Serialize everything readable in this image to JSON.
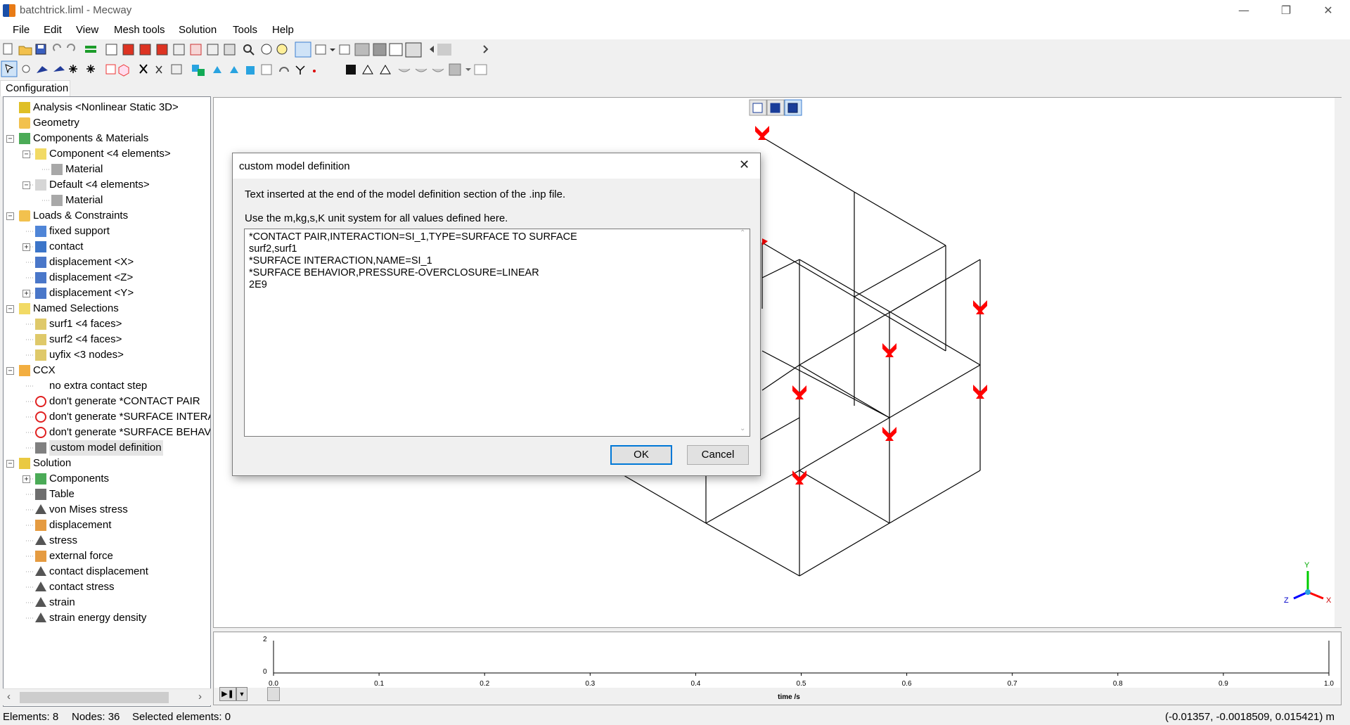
{
  "window": {
    "title": "batchtrick.liml - Mecway",
    "controls": [
      "minimize",
      "restore",
      "close"
    ]
  },
  "menu": [
    "File",
    "Edit",
    "View",
    "Mesh tools",
    "Solution",
    "Tools",
    "Help"
  ],
  "sidebar": {
    "tab": "Configuration",
    "tree": [
      {
        "label": "Analysis <Nonlinear Static 3D>",
        "icon": "analysis-icon",
        "level": 0,
        "expander": ""
      },
      {
        "label": "Geometry",
        "icon": "folder-icon",
        "level": 0,
        "expander": ""
      },
      {
        "label": "Components & Materials",
        "icon": "components-icon",
        "level": 0,
        "expander": "−"
      },
      {
        "label": "Component <4 elements>",
        "icon": "component-icon",
        "level": 1,
        "expander": "−"
      },
      {
        "label": "Material",
        "icon": "material-icon",
        "level": 2,
        "expander": ""
      },
      {
        "label": "Default <4 elements>",
        "icon": "component-default-icon",
        "level": 1,
        "expander": "−"
      },
      {
        "label": "Material",
        "icon": "material-icon",
        "level": 2,
        "expander": ""
      },
      {
        "label": "Loads & Constraints",
        "icon": "loads-folder-icon",
        "level": 0,
        "expander": "−"
      },
      {
        "label": "fixed support",
        "icon": "fixed-support-icon",
        "level": 1,
        "expander": ""
      },
      {
        "label": "contact",
        "icon": "contact-icon",
        "level": 1,
        "expander": "+"
      },
      {
        "label": "displacement <X>",
        "icon": "displacement-constraint-icon",
        "level": 1,
        "expander": ""
      },
      {
        "label": "displacement <Z>",
        "icon": "displacement-constraint-icon",
        "level": 1,
        "expander": ""
      },
      {
        "label": "displacement <Y>",
        "icon": "displacement-constraint-icon",
        "level": 1,
        "expander": "+"
      },
      {
        "label": "Named Selections",
        "icon": "named-selections-icon",
        "level": 0,
        "expander": "−"
      },
      {
        "label": "surf1 <4 faces>",
        "icon": "face-selection-icon",
        "level": 1,
        "expander": ""
      },
      {
        "label": "surf2 <4 faces>",
        "icon": "face-selection-icon",
        "level": 1,
        "expander": ""
      },
      {
        "label": "uyfix <3 nodes>",
        "icon": "node-selection-icon",
        "level": 1,
        "expander": ""
      },
      {
        "label": "CCX",
        "icon": "ccx-icon",
        "level": 0,
        "expander": "−"
      },
      {
        "label": "no extra contact step",
        "icon": "",
        "level": 1,
        "expander": ""
      },
      {
        "label": "don't generate *CONTACT PAIR",
        "icon": "no-generate-icon",
        "level": 1,
        "expander": ""
      },
      {
        "label": "don't generate *SURFACE INTERA",
        "icon": "no-generate-icon",
        "level": 1,
        "expander": ""
      },
      {
        "label": "don't generate *SURFACE BEHAV",
        "icon": "no-generate-icon",
        "level": 1,
        "expander": ""
      },
      {
        "label": "custom model definition",
        "icon": "custom-definition-icon",
        "level": 1,
        "expander": "",
        "selected": true
      },
      {
        "label": "Solution",
        "icon": "solution-icon",
        "level": 0,
        "expander": "−"
      },
      {
        "label": "Components",
        "icon": "components-icon",
        "level": 1,
        "expander": "+"
      },
      {
        "label": "Table",
        "icon": "table-icon",
        "level": 1,
        "expander": ""
      },
      {
        "label": "von Mises stress",
        "icon": "triangle-icon",
        "level": 1,
        "expander": ""
      },
      {
        "label": "displacement",
        "icon": "displacement-arrow-icon",
        "level": 1,
        "expander": ""
      },
      {
        "label": "stress",
        "icon": "triangle-icon",
        "level": 1,
        "expander": ""
      },
      {
        "label": "external force",
        "icon": "displacement-arrow-icon",
        "level": 1,
        "expander": ""
      },
      {
        "label": "contact displacement",
        "icon": "triangle-icon",
        "level": 1,
        "expander": ""
      },
      {
        "label": "contact stress",
        "icon": "triangle-icon",
        "level": 1,
        "expander": ""
      },
      {
        "label": "strain",
        "icon": "triangle-icon",
        "level": 1,
        "expander": ""
      },
      {
        "label": "strain energy density",
        "icon": "triangle-icon",
        "level": 1,
        "expander": ""
      }
    ]
  },
  "dialog": {
    "title": "custom model definition",
    "description": "Text inserted at the end of the model definition section of the .inp file.",
    "units_note": "Use the m,kg,s,K unit system for all values defined here.",
    "content": "*CONTACT PAIR,INTERACTION=SI_1,TYPE=SURFACE TO SURFACE\nsurf2,surf1\n*SURFACE INTERACTION,NAME=SI_1\n*SURFACE BEHAVIOR,PRESSURE-OVERCLOSURE=LINEAR\n2E9",
    "ok_label": "OK",
    "cancel_label": "Cancel"
  },
  "viewport": {
    "axis_labels": [
      "Y",
      "Z",
      "X"
    ],
    "colors": {
      "constraint": "#ff0000",
      "mesh": "#000000",
      "axis_x": "#ff0000",
      "axis_y": "#00cc00",
      "axis_z": "#0000ff"
    }
  },
  "timeline": {
    "y_ticks": [
      "2",
      "0"
    ],
    "x_ticks": [
      "0.0",
      "0.1",
      "0.2",
      "0.3",
      "0.4",
      "0.5",
      "0.6",
      "0.7",
      "0.8",
      "0.9",
      "1.0"
    ],
    "x_label": "time /s"
  },
  "status": {
    "elements": "Elements: 8",
    "nodes": "Nodes: 36",
    "selected": "Selected elements: 0",
    "coordinates": "(-0.01357, -0.0018509, 0.015421) m"
  }
}
